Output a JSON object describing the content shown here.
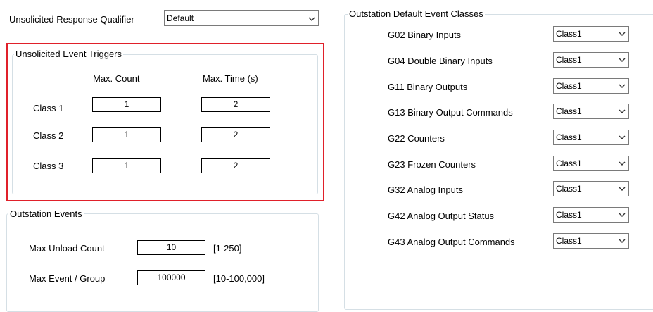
{
  "unsolicited_qualifier": {
    "label": "Unsolicited Response Qualifier",
    "value": "Default"
  },
  "triggers": {
    "title": "Unsolicited Event Triggers",
    "col_count": "Max. Count",
    "col_time": "Max. Time (s)",
    "rows": [
      {
        "label": "Class 1",
        "count": "1",
        "time": "2"
      },
      {
        "label": "Class 2",
        "count": "1",
        "time": "2"
      },
      {
        "label": "Class 3",
        "count": "1",
        "time": "2"
      }
    ]
  },
  "outstation_events": {
    "title": "Outstation Events",
    "max_unload_label": "Max Unload Count",
    "max_unload_value": "10",
    "max_unload_range": "[1-250]",
    "max_event_label": "Max Event / Group",
    "max_event_value": "100000",
    "max_event_range": "[10-100,000]"
  },
  "default_classes": {
    "title": "Outstation Default Event Classes",
    "items": [
      {
        "label": "G02 Binary Inputs",
        "value": "Class1"
      },
      {
        "label": "G04 Double Binary Inputs",
        "value": "Class1"
      },
      {
        "label": "G11 Binary Outputs",
        "value": "Class1"
      },
      {
        "label": "G13 Binary Output Commands",
        "value": "Class1"
      },
      {
        "label": "G22 Counters",
        "value": "Class1"
      },
      {
        "label": "G23 Frozen Counters",
        "value": "Class1"
      },
      {
        "label": "G32 Analog Inputs",
        "value": "Class1"
      },
      {
        "label": "G42 Analog Output Status",
        "value": "Class1"
      },
      {
        "label": "G43 Analog Output Commands",
        "value": "Class1"
      }
    ]
  },
  "icons": {
    "dropdown_arrow": "chevron-down-icon"
  },
  "colors": {
    "highlight": "#e0202a",
    "group_border": "#d5dfe5"
  }
}
